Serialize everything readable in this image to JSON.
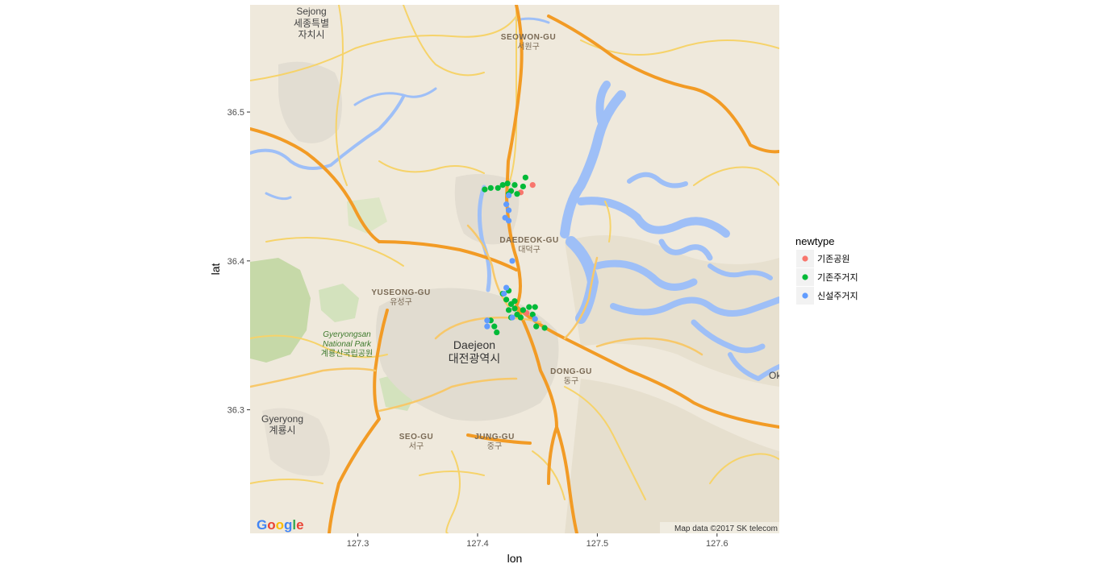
{
  "chart_data": {
    "type": "scatter",
    "xlabel": "lon",
    "ylabel": "lat",
    "xlim": [
      127.21,
      127.652
    ],
    "ylim": [
      36.217,
      36.572
    ],
    "x_ticks": [
      127.3,
      127.4,
      127.5,
      127.6
    ],
    "x_tick_labels": [
      "127.3",
      "127.4",
      "127.5",
      "127.6"
    ],
    "y_ticks": [
      36.3,
      36.4,
      36.5
    ],
    "y_tick_labels": [
      "36.3",
      "36.4",
      "36.5"
    ],
    "legend": {
      "title": "newtype",
      "placement": "right",
      "entries": [
        {
          "label": "기존공원",
          "color": "#F8766D"
        },
        {
          "label": "기존주거지",
          "color": "#00BA38"
        },
        {
          "label": "신설주거지",
          "color": "#619CFF"
        }
      ]
    },
    "series": [
      {
        "name": "기존공원",
        "color": "#F8766D",
        "points": [
          [
            127.446,
            36.451
          ],
          [
            127.436,
            36.446
          ],
          [
            127.441,
            36.365
          ]
        ]
      },
      {
        "name": "기존주거지",
        "color": "#00BA38",
        "points": [
          [
            127.406,
            36.448
          ],
          [
            127.411,
            36.449
          ],
          [
            127.417,
            36.449
          ],
          [
            127.421,
            36.451
          ],
          [
            127.425,
            36.452
          ],
          [
            127.428,
            36.447
          ],
          [
            127.431,
            36.451
          ],
          [
            127.438,
            36.45
          ],
          [
            127.433,
            36.445
          ],
          [
            127.44,
            36.456
          ],
          [
            127.426,
            36.445
          ],
          [
            127.421,
            36.378
          ],
          [
            127.426,
            36.38
          ],
          [
            127.424,
            36.374
          ],
          [
            127.428,
            36.371
          ],
          [
            127.431,
            36.373
          ],
          [
            127.426,
            36.367
          ],
          [
            127.431,
            36.368
          ],
          [
            127.428,
            36.362
          ],
          [
            127.433,
            36.364
          ],
          [
            127.436,
            36.362
          ],
          [
            127.438,
            36.367
          ],
          [
            127.443,
            36.369
          ],
          [
            127.446,
            36.364
          ],
          [
            127.448,
            36.369
          ],
          [
            127.449,
            36.356
          ],
          [
            127.456,
            36.355
          ],
          [
            127.414,
            36.356
          ],
          [
            127.416,
            36.352
          ],
          [
            127.411,
            36.36
          ]
        ]
      },
      {
        "name": "신설주거지",
        "color": "#619CFF",
        "points": [
          [
            127.426,
            36.444
          ],
          [
            127.424,
            36.438
          ],
          [
            127.426,
            36.434
          ],
          [
            127.423,
            36.429
          ],
          [
            127.426,
            36.427
          ],
          [
            127.429,
            36.4
          ],
          [
            127.424,
            36.382
          ],
          [
            127.422,
            36.378
          ],
          [
            127.408,
            36.36
          ],
          [
            127.408,
            36.356
          ],
          [
            127.429,
            36.362
          ],
          [
            127.448,
            36.361
          ]
        ]
      }
    ]
  },
  "basemap": {
    "places": {
      "sejong_en": "Sejong",
      "sejong_ko1": "세종특별",
      "sejong_ko2": "자치시",
      "seowon_en": "SEOWON-GU",
      "seowon_ko": "서원구",
      "daedeok_en": "DAEDEOK-GU",
      "daedeok_ko": "대덕구",
      "yuseong_en": "YUSEONG-GU",
      "yuseong_ko": "유성구",
      "park_en1": "Gyeryongsan",
      "park_en2": "National Park",
      "park_ko": "계룡산국립공원",
      "daejeon_en": "Daejeon",
      "daejeon_ko": "대전광역시",
      "dong_en": "DONG-GU",
      "dong_ko": "동구",
      "gyeryong_en": "Gyeryong",
      "gyeryong_ko": "계룡시",
      "seo_en": "SEO-GU",
      "seo_ko": "서구",
      "jung_en": "JUNG-GU",
      "jung_ko": "중구",
      "edge": "Ok"
    },
    "attribution": "Map data ©2017 SK telecom",
    "logo_letters": [
      "G",
      "o",
      "o",
      "g",
      "l",
      "e"
    ],
    "colors": {
      "land": "#efe9dc",
      "water": "#9ebff7",
      "highway": "#f29b25",
      "road": "#f6d36a",
      "forest": "#c9dcb0",
      "urban": "#e4ded2"
    }
  }
}
